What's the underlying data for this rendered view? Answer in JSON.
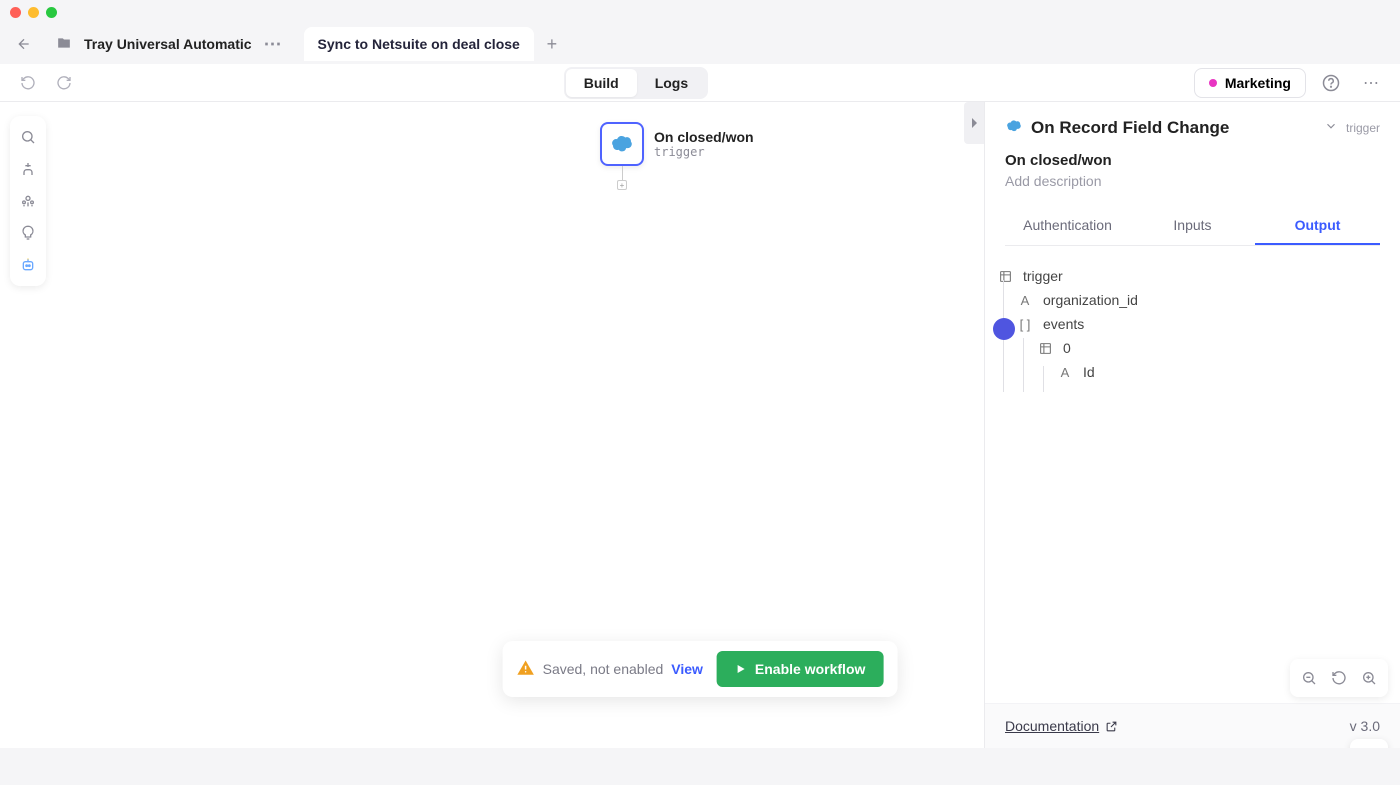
{
  "tabs": {
    "inactive_label": "Tray Universal Automatic",
    "active_label": "Sync to Netsuite on deal close"
  },
  "toolbar": {
    "build": "Build",
    "logs": "Logs",
    "workspace": "Marketing"
  },
  "canvas": {
    "node_title": "On closed/won",
    "node_sub": "trigger"
  },
  "panel": {
    "title": "On Record Field Change",
    "badge": "trigger",
    "subtitle": "On closed/won",
    "description": "Add description",
    "tabs": {
      "auth": "Authentication",
      "inputs": "Inputs",
      "output": "Output"
    },
    "tree": {
      "root": "trigger",
      "org": "organization_id",
      "events": "events",
      "zero": "0",
      "id": "Id"
    },
    "doc": "Documentation",
    "version": "v 3.0"
  },
  "status": {
    "text": "Saved, not enabled",
    "view": "View",
    "enable": "Enable workflow"
  }
}
